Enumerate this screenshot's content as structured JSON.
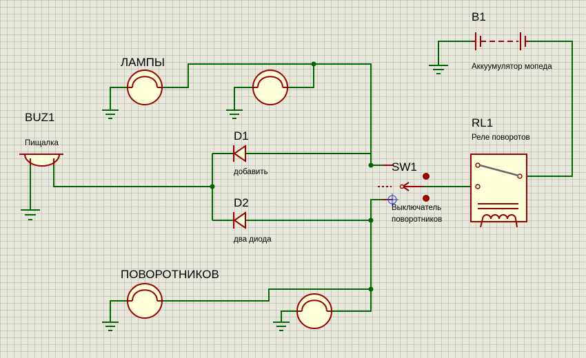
{
  "buzzer": {
    "ref": "BUZ1",
    "value": "Пищалка"
  },
  "lamps_group": {
    "label": "ЛАМПЫ"
  },
  "turn_lamps_group": {
    "label": "ПОВОРОТНИКОВ"
  },
  "diode1": {
    "ref": "D1",
    "value": "добавить"
  },
  "diode2": {
    "ref": "D2",
    "value": "два диода"
  },
  "switch": {
    "ref": "SW1",
    "value_line1": "Выключатель",
    "value_line2": "поворотников"
  },
  "battery": {
    "ref": "B1",
    "value": "Аккуумулятор мопеда"
  },
  "relay": {
    "ref": "RL1",
    "value": "Реле поворотов"
  },
  "colors": {
    "wire": "#006600",
    "component": "#990000",
    "component_fill": "#ffffd8",
    "pin_dot": "#990000",
    "background": "#e8e8dc"
  }
}
